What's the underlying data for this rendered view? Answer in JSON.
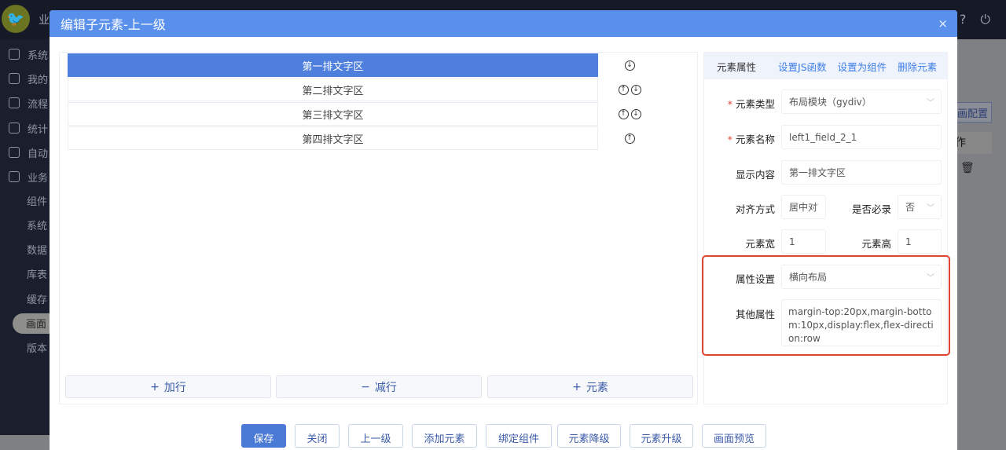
{
  "app": {
    "title_visible": "业"
  },
  "sidebar": {
    "items": [
      {
        "label": "系统",
        "icon": "settings-icon"
      },
      {
        "label": "我的",
        "icon": "desktop-icon"
      },
      {
        "label": "流程",
        "icon": "flow-icon"
      },
      {
        "label": "统计",
        "icon": "stats-icon"
      },
      {
        "label": "自动",
        "icon": "auto-icon"
      },
      {
        "label": "业务",
        "icon": "business-icon"
      }
    ],
    "subitems": [
      "组件",
      "系统",
      "数据",
      "库表",
      "缓存",
      "画面",
      "版本"
    ],
    "active_subitem": "画面"
  },
  "background": {
    "config_button": "画配置",
    "column_header": "作"
  },
  "modal": {
    "title": "编辑子元素-上一级",
    "close": "×",
    "rows": [
      {
        "label": "第一排文字区",
        "up": false,
        "down": true,
        "selected": true
      },
      {
        "label": "第二排文字区",
        "up": true,
        "down": true,
        "selected": false
      },
      {
        "label": "第三排文字区",
        "up": true,
        "down": true,
        "selected": false
      },
      {
        "label": "第四排文字区",
        "up": true,
        "down": false,
        "selected": false
      }
    ],
    "left_buttons": {
      "add_row": "加行",
      "remove_row": "减行",
      "add_element": "元素"
    },
    "props": {
      "header": "元素属性",
      "link_js": "设置JS函数",
      "link_component": "设置为组件",
      "link_delete": "删除元素",
      "type_label": "元素类型",
      "type_value": "布局模块（gydiv）",
      "name_label": "元素名称",
      "name_value": "left1_field_2_1",
      "content_label": "显示内容",
      "content_value": "第一排文字区",
      "align_label": "对齐方式",
      "align_value": "居中对",
      "required_label": "是否必录",
      "required_value": "否",
      "width_label": "元素宽",
      "width_value": "1",
      "height_label": "元素高",
      "height_value": "1",
      "attr_label": "属性设置",
      "attr_value": "横向布局",
      "other_label": "其他属性",
      "other_value": "margin-top:20px,margin-bottom:10px,display:flex,flex-direction:row"
    },
    "footer": [
      "保存",
      "关闭",
      "上一级",
      "添加元素",
      "绑定组件",
      "元素降级",
      "元素升级",
      "画面预览"
    ]
  }
}
